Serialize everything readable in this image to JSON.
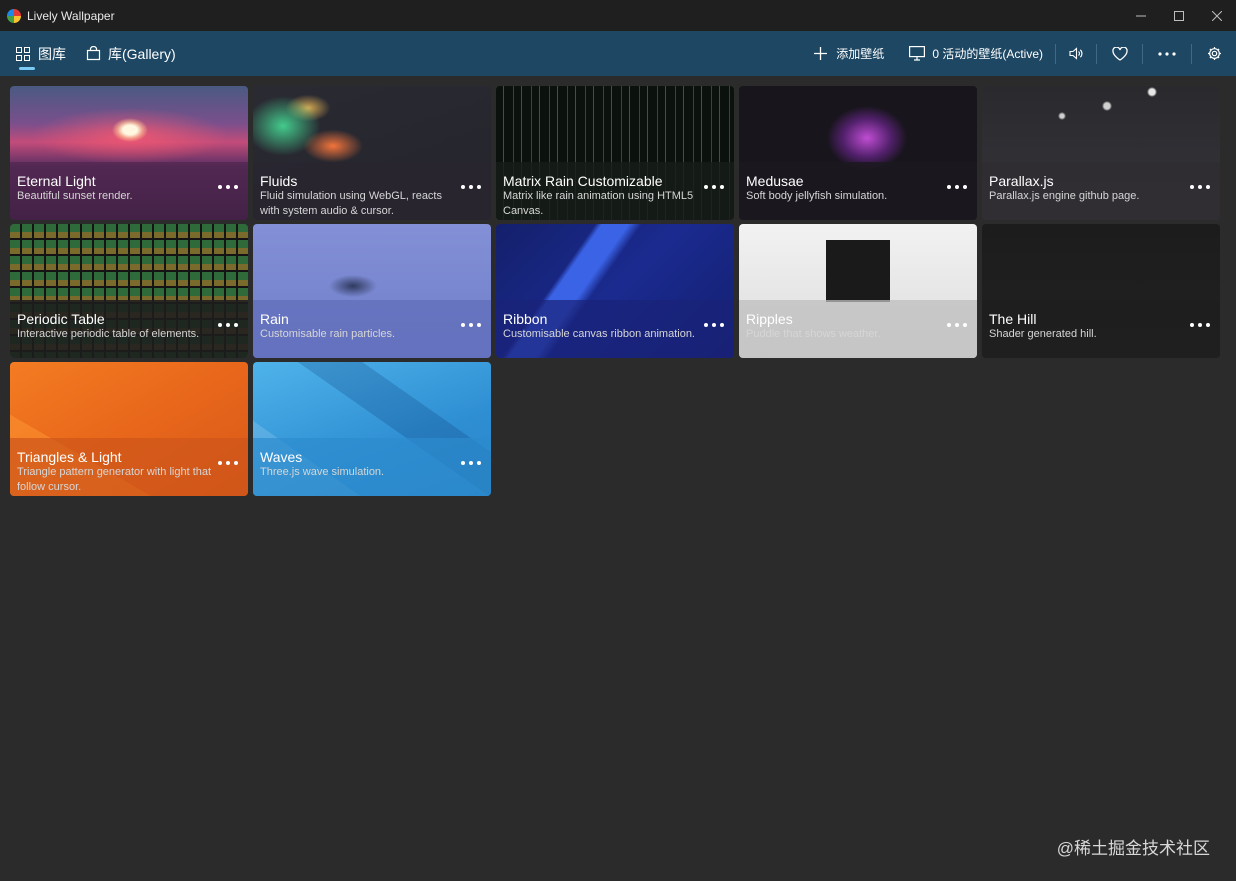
{
  "window": {
    "title": "Lively Wallpaper",
    "minimize": "—",
    "maximize": "☐",
    "close": "✕"
  },
  "nav": {
    "tabs": [
      {
        "label": "图库"
      },
      {
        "label": "库(Gallery)"
      }
    ],
    "actions": {
      "add_wallpaper": "添加壁纸",
      "active_wallpapers": "0 活动的壁纸(Active)"
    }
  },
  "wallpapers": [
    {
      "title": "Eternal Light",
      "desc": "Beautiful sunset render."
    },
    {
      "title": "Fluids",
      "desc": "Fluid simulation using WebGL, reacts with system audio & cursor."
    },
    {
      "title": "Matrix Rain Customizable",
      "desc": "Matrix like rain animation using HTML5 Canvas."
    },
    {
      "title": "Medusae",
      "desc": "Soft body jellyfish simulation."
    },
    {
      "title": "Parallax.js",
      "desc": "Parallax.js engine github page."
    },
    {
      "title": "Periodic Table",
      "desc": "Interactive periodic table of elements."
    },
    {
      "title": "Rain",
      "desc": "Customisable rain particles."
    },
    {
      "title": "Ribbon",
      "desc": "Customisable canvas ribbon animation."
    },
    {
      "title": "Ripples",
      "desc": "Puddle that shows weather."
    },
    {
      "title": "The Hill",
      "desc": "Shader generated hill."
    },
    {
      "title": "Triangles & Light",
      "desc": "Triangle pattern generator with light that follow cursor."
    },
    {
      "title": "Waves",
      "desc": "Three.js wave simulation."
    }
  ],
  "watermark": "@稀土掘金技术社区",
  "colors": {
    "titlebar": "#1f1f1f",
    "navbar": "#1d4763",
    "background": "#2b2b2b",
    "accent": "#7ccbf5"
  }
}
